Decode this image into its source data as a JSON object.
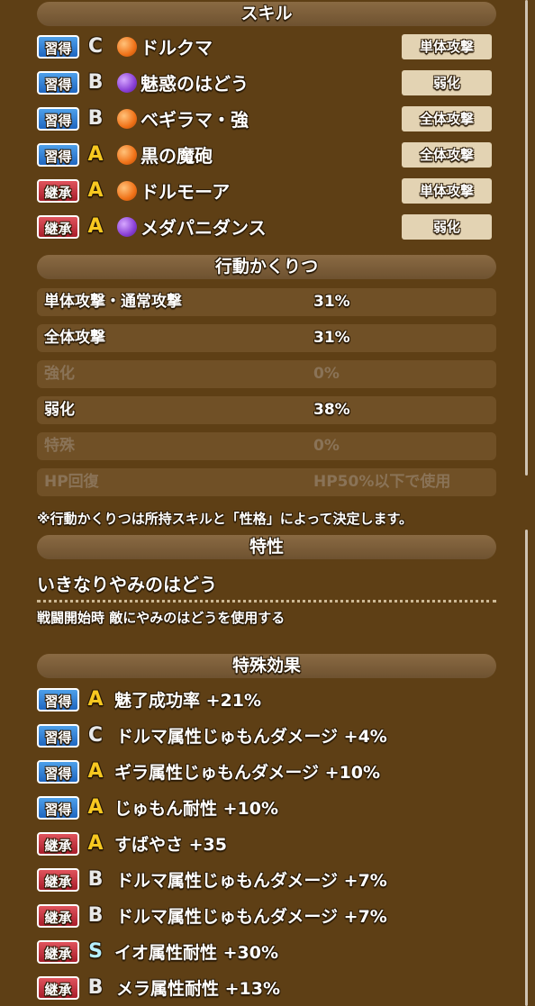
{
  "sections": {
    "skills": "スキル",
    "action_rates": "行動かくりつ",
    "trait": "特性",
    "special_effects": "特殊効果"
  },
  "skills": [
    {
      "badge": "習得",
      "rank": "C",
      "element": "fire",
      "name": "ドルクマ",
      "tag": "単体攻撃"
    },
    {
      "badge": "習得",
      "rank": "B",
      "element": "dark",
      "name": "魅惑のはどう",
      "tag": "弱化"
    },
    {
      "badge": "習得",
      "rank": "B",
      "element": "fire",
      "name": "ベギラマ・強",
      "tag": "全体攻撃"
    },
    {
      "badge": "習得",
      "rank": "A",
      "element": "fire",
      "name": "黒の魔砲",
      "tag": "全体攻撃"
    },
    {
      "badge": "継承",
      "rank": "A",
      "element": "fire",
      "name": "ドルモーア",
      "tag": "単体攻撃"
    },
    {
      "badge": "継承",
      "rank": "A",
      "element": "dark",
      "name": "メダパニダンス",
      "tag": "弱化"
    }
  ],
  "action_rates": [
    {
      "label": "単体攻撃・通常攻撃",
      "value": "31%"
    },
    {
      "label": "全体攻撃",
      "value": "31%"
    },
    {
      "label": "強化",
      "value": "0%"
    },
    {
      "label": "弱化",
      "value": "38%"
    },
    {
      "label": "特殊",
      "value": "0%"
    },
    {
      "label": "HP回復",
      "value": "HP50%以下で使用"
    }
  ],
  "action_note": "※行動かくりつは所持スキルと「性格」によって決定します。",
  "trait": {
    "name": "いきなりやみのはどう",
    "description": "戦闘開始時 敵にやみのはどうを使用する"
  },
  "special_effects": [
    {
      "badge": "習得",
      "rank": "A",
      "text": "魅了成功率 +21%"
    },
    {
      "badge": "習得",
      "rank": "C",
      "text": "ドルマ属性じゅもんダメージ +4%"
    },
    {
      "badge": "習得",
      "rank": "A",
      "text": "ギラ属性じゅもんダメージ +10%"
    },
    {
      "badge": "習得",
      "rank": "A",
      "text": "じゅもん耐性 +10%"
    },
    {
      "badge": "継承",
      "rank": "A",
      "text": "すばやさ +35"
    },
    {
      "badge": "継承",
      "rank": "B",
      "text": "ドルマ属性じゅもんダメージ +7%"
    },
    {
      "badge": "継承",
      "rank": "B",
      "text": "ドルマ属性じゅもんダメージ +7%"
    },
    {
      "badge": "継承",
      "rank": "S",
      "text": "イオ属性耐性 +30%"
    },
    {
      "badge": "継承",
      "rank": "B",
      "text": "メラ属性耐性 +13%"
    }
  ]
}
